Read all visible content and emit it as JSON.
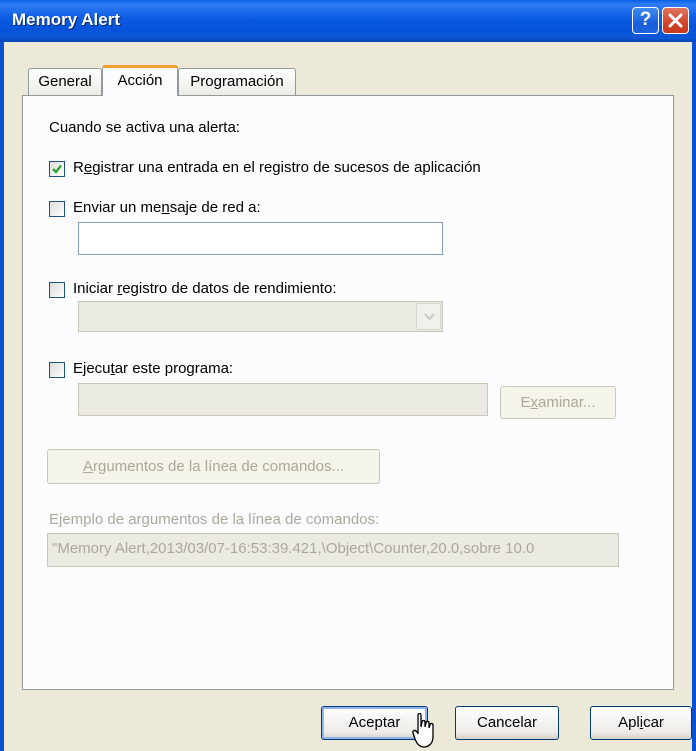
{
  "window": {
    "title": "Memory Alert",
    "help_label": "?"
  },
  "tabs": [
    {
      "label": "General",
      "active": false
    },
    {
      "label": "Acción",
      "active": true
    },
    {
      "label": "Programación",
      "active": false
    }
  ],
  "panel": {
    "intro": "Cuando se activa una alerta:",
    "log_event": {
      "pre": "R",
      "key": "e",
      "post": "gistrar una entrada en el registro de sucesos de aplicación",
      "checked": true
    },
    "send_message": {
      "pre": "Enviar un me",
      "key": "n",
      "post": "saje de red a:",
      "checked": false,
      "value": ""
    },
    "start_log": {
      "pre": "Iniciar ",
      "key": "r",
      "post": "egistro de datos de rendimiento:",
      "checked": false,
      "selected": ""
    },
    "run_program": {
      "pre": "Ejecu",
      "key": "t",
      "post": "ar este programa:",
      "checked": false,
      "value": ""
    },
    "browse_button": {
      "pre": "E",
      "key": "x",
      "post": "aminar..."
    },
    "args_button": {
      "pre": "",
      "key": "A",
      "post": "rgumentos de la línea de comandos..."
    },
    "example_label": "Ejemplo de argumentos de la línea de comandos:",
    "example_value": "\"Memory Alert,2013/03/07-16:53:39.421,\\Object\\Counter,20.0,sobre 10.0"
  },
  "footer": {
    "ok_label": "Aceptar",
    "cancel_label": "Cancelar",
    "apply": {
      "pre": "Apl",
      "key": "i",
      "post": "car"
    }
  },
  "icons": {
    "help": "question-mark-icon",
    "close": "close-x-icon",
    "check": "checkmark-icon",
    "dropdown": "chevron-down-icon",
    "cursor": "mouse-pointer-icon"
  }
}
